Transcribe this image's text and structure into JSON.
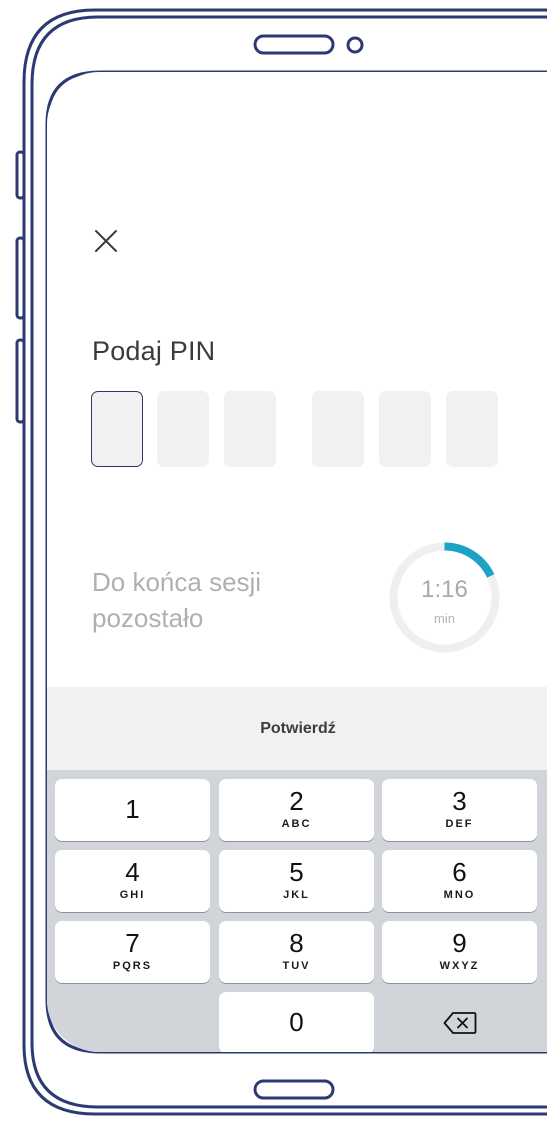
{
  "screen": {
    "close_icon": "close-icon",
    "pin_label": "Podaj PIN",
    "pin_length": 6,
    "session": {
      "label_line1": "Do końca sesji",
      "label_line2": "pozostało",
      "time": "1:16",
      "unit": "min",
      "remaining_fraction": 0.18
    },
    "confirm_label": "Potwierdź"
  },
  "keypad": {
    "keys": [
      {
        "digit": "1",
        "letters": ""
      },
      {
        "digit": "2",
        "letters": "ABC"
      },
      {
        "digit": "3",
        "letters": "DEF"
      },
      {
        "digit": "4",
        "letters": "GHI"
      },
      {
        "digit": "5",
        "letters": "JKL"
      },
      {
        "digit": "6",
        "letters": "MNO"
      },
      {
        "digit": "7",
        "letters": "PQRS"
      },
      {
        "digit": "8",
        "letters": "TUV"
      },
      {
        "digit": "9",
        "letters": "WXYZ"
      },
      {
        "digit": "0",
        "letters": ""
      }
    ],
    "backspace_icon": "backspace-icon"
  },
  "colors": {
    "frame": "#2b3a73",
    "timer_accent": "#1aa3c4",
    "timer_track": "#efefef",
    "pin_active_border": "#2b3a63",
    "keypad_bg": "#d1d4d9"
  }
}
